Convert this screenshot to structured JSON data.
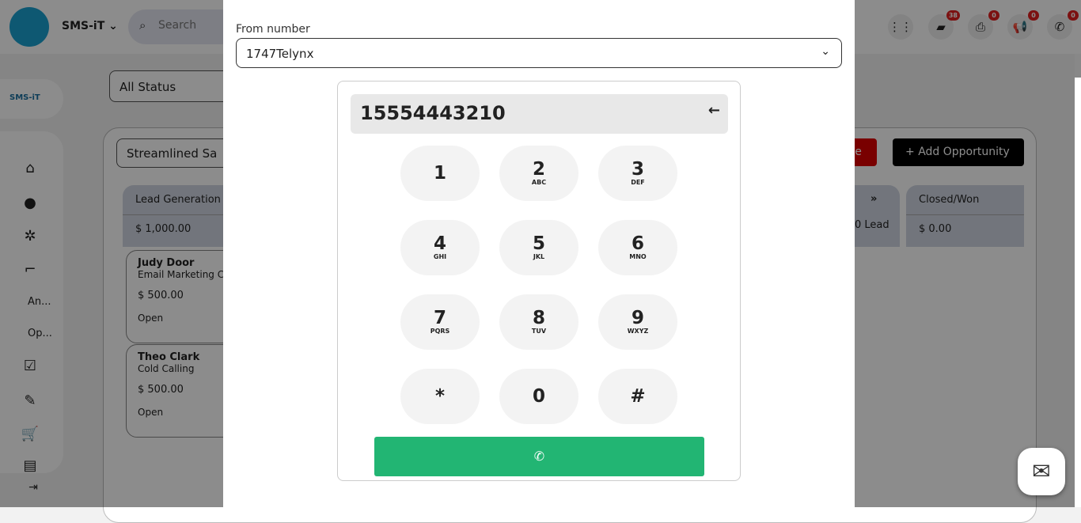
{
  "header": {
    "brand": "SMS-iT",
    "search_placeholder": "Search",
    "icons": [
      {
        "name": "apps-grid-icon",
        "badge": null
      },
      {
        "name": "chat-icon",
        "badge": "38"
      },
      {
        "name": "fax-icon",
        "badge": "0"
      },
      {
        "name": "megaphone-icon",
        "badge": "0"
      },
      {
        "name": "phone-icon",
        "badge": "0"
      }
    ]
  },
  "sidebar": {
    "logo": "SMS-iT",
    "items": [
      "An...",
      "Op..."
    ]
  },
  "filters": {
    "status": "All Status",
    "pipeline": "Streamlined Sa"
  },
  "board": {
    "save_partial": "ve",
    "add_label": "Add Opportunity",
    "columns": [
      {
        "title": "Lead Generation",
        "total": "$ 1,000.00"
      },
      {
        "title": "Closed/Won",
        "total": "$ 0.00"
      }
    ],
    "partial_total": "0 Lead",
    "cards": [
      {
        "name": "Judy Door",
        "source": "Email Marketing C",
        "amount": "$ 500.00",
        "status": "Open"
      },
      {
        "name": "Theo Clark",
        "source": "Cold Calling",
        "amount": "$ 500.00",
        "status": "Open"
      }
    ]
  },
  "modal": {
    "from_label": "From number",
    "from_value": "1747Telynx",
    "dialed": "15554443210",
    "keys": [
      {
        "d": "1",
        "l": ""
      },
      {
        "d": "2",
        "l": "ABC"
      },
      {
        "d": "3",
        "l": "DEF"
      },
      {
        "d": "4",
        "l": "GHI"
      },
      {
        "d": "5",
        "l": "JKL"
      },
      {
        "d": "6",
        "l": "MNO"
      },
      {
        "d": "7",
        "l": "PQRS"
      },
      {
        "d": "8",
        "l": "TUV"
      },
      {
        "d": "9",
        "l": "WXYZ"
      },
      {
        "d": "*",
        "l": ""
      },
      {
        "d": "0",
        "l": ""
      },
      {
        "d": "#",
        "l": ""
      }
    ]
  },
  "colors": {
    "call": "#22b573",
    "badge": "#e02020",
    "add": "#000000"
  }
}
